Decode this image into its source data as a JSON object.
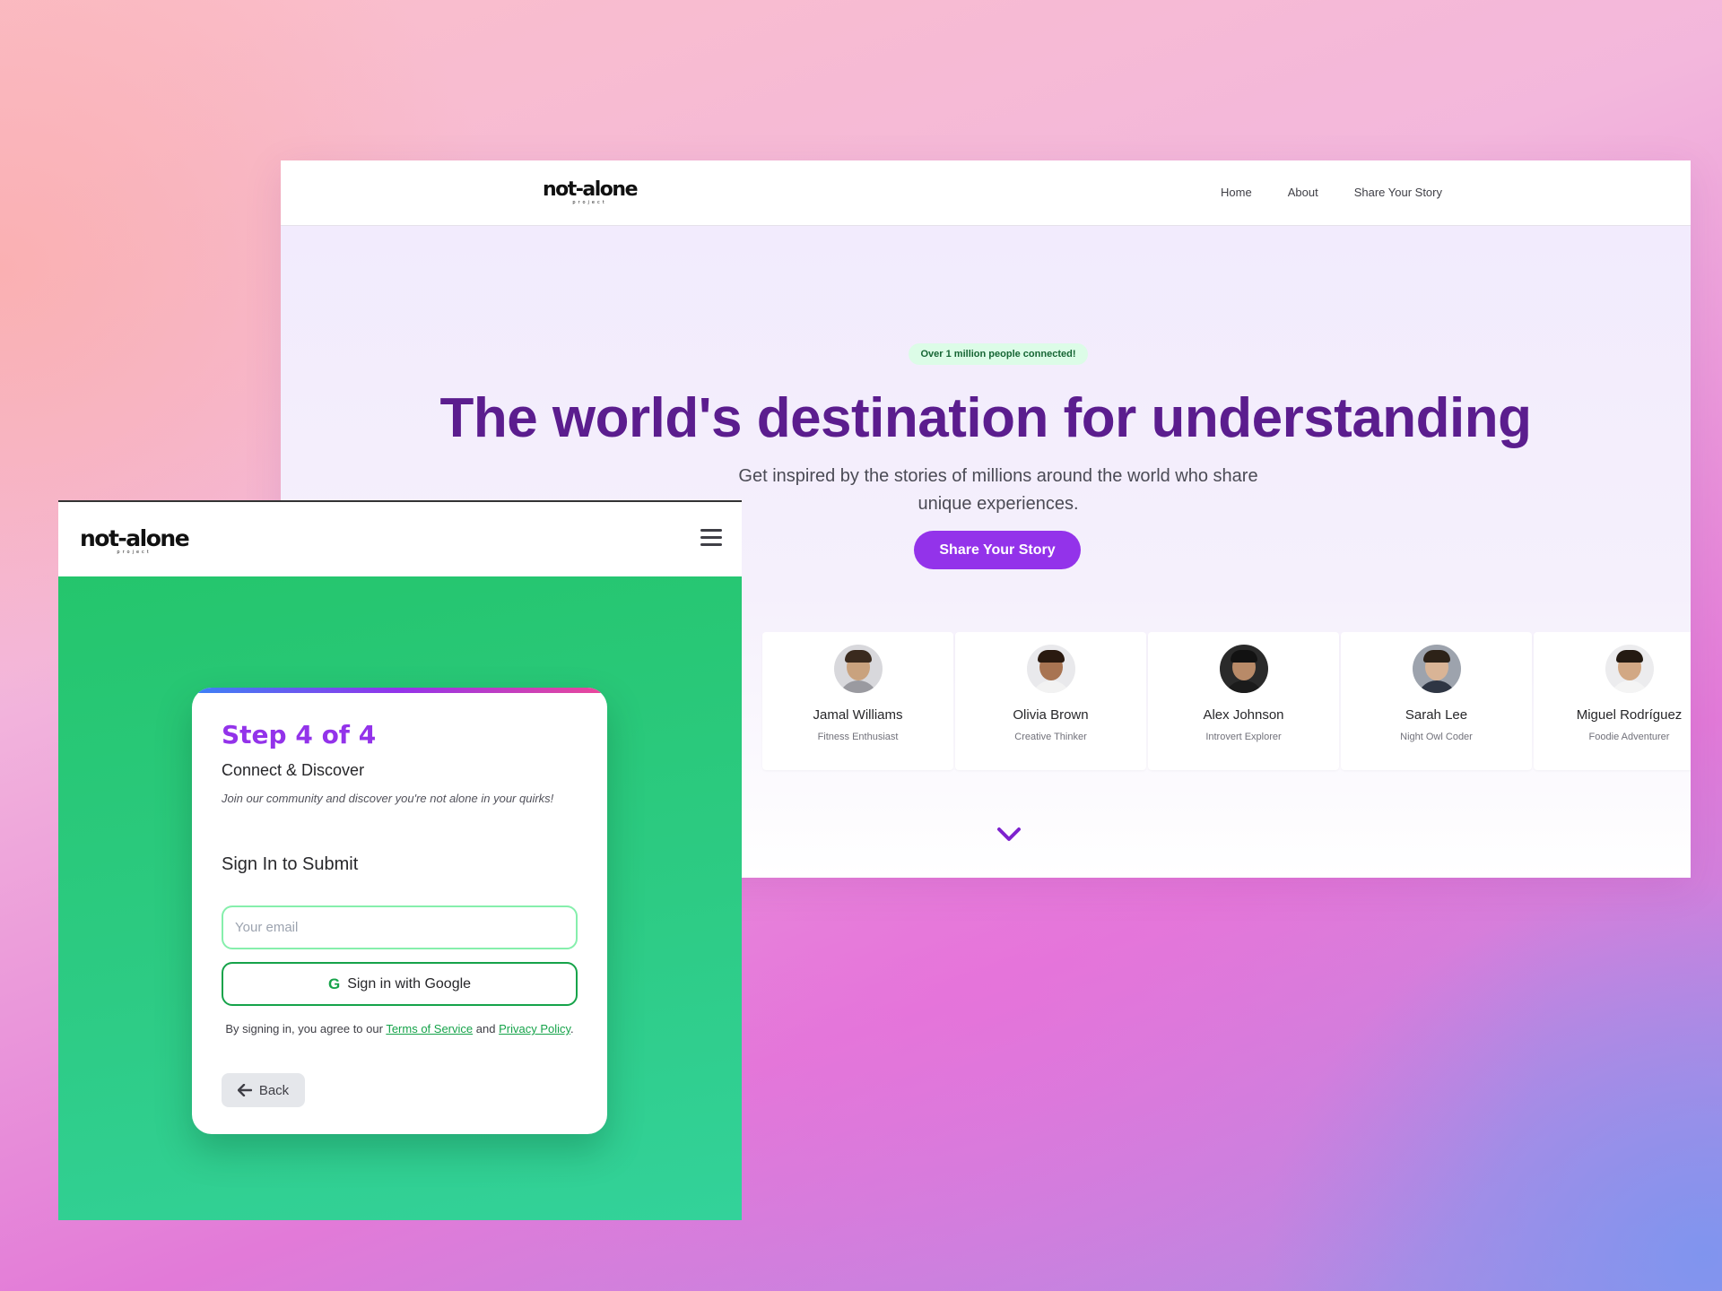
{
  "desktop": {
    "logo": "not-alone",
    "logo_sub": "project",
    "nav": [
      "Home",
      "About",
      "Share Your Story"
    ],
    "badge": "Over 1 million people connected!",
    "title": "The world's destination for understanding",
    "subtitle": "Get inspired by the stories of millions around the world who share unique experiences.",
    "cta": "Share Your Story",
    "profiles": [
      {
        "name": "Jamal Williams",
        "role": "Fitness Enthusiast",
        "skin": "#c9a27e",
        "hair": "#3a2a1e",
        "shirt": "#9a9aa0",
        "bg": "#d8d8dc"
      },
      {
        "name": "Olivia Brown",
        "role": "Creative Thinker",
        "skin": "#a87452",
        "hair": "#2a1a10",
        "shirt": "#f2f2f2",
        "bg": "#e9e9ec"
      },
      {
        "name": "Alex Johnson",
        "role": "Introvert Explorer",
        "skin": "#b88a68",
        "hair": "#121212",
        "shirt": "#1b1b1b",
        "bg": "#2a2a2a"
      },
      {
        "name": "Sarah Lee",
        "role": "Night Owl Coder",
        "skin": "#d9b496",
        "hair": "#2d2218",
        "shirt": "#2f3644",
        "bg": "#9da3ad"
      },
      {
        "name": "Miguel Rodríguez",
        "role": "Foodie Adventurer",
        "skin": "#d2a884",
        "hair": "#241a12",
        "shirt": "#f4f4f4",
        "bg": "#ececee"
      }
    ]
  },
  "mobile": {
    "logo": "not-alone",
    "logo_sub": "project",
    "step_title": "Step 4 of 4",
    "step_subtitle": "Connect & Discover",
    "step_desc": "Join our community and discover you're not alone in your quirks!",
    "signin_title": "Sign In to Submit",
    "email_placeholder": "Your email",
    "google_btn": "Sign in with Google",
    "terms_prefix": "By signing in, you agree to our",
    "terms_link": "Terms of Service",
    "terms_and": "and",
    "privacy_link": "Privacy Policy",
    "terms_end": ".",
    "back": "Back"
  },
  "colors": {
    "brand_purple": "#9333ea",
    "title_purple": "#5b1d8e",
    "brand_green": "#16a34a"
  }
}
